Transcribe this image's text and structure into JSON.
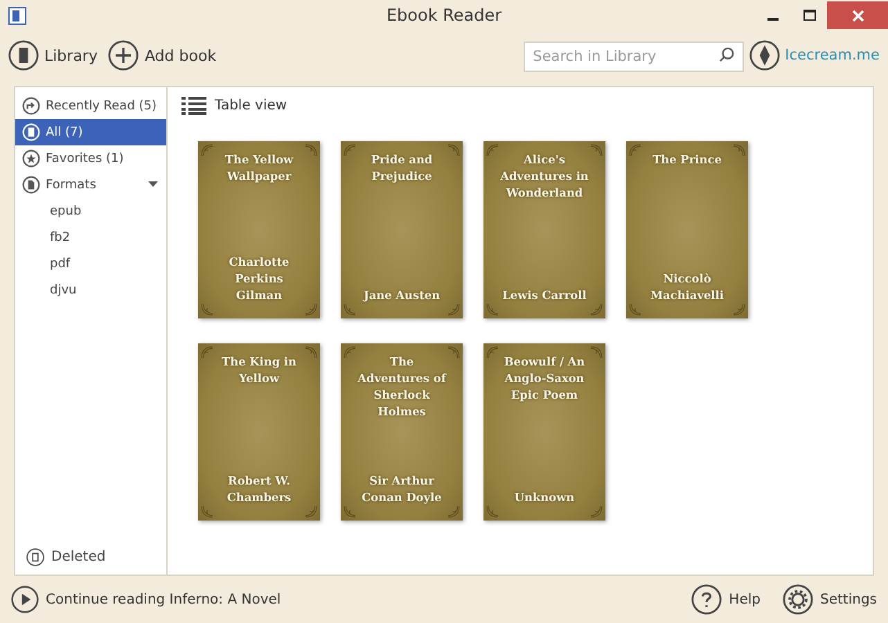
{
  "window": {
    "title": "Ebook Reader"
  },
  "toolbar": {
    "library": "Library",
    "add_book": "Add book",
    "search": {
      "placeholder": "Search in Library"
    },
    "brand": "Icecream.me"
  },
  "sidebar": {
    "items": [
      {
        "kind": "recent",
        "label": "Recently Read (5)",
        "selected": false
      },
      {
        "kind": "all",
        "label": "All (7)",
        "selected": true
      },
      {
        "kind": "favorites",
        "label": "Favorites (1)",
        "selected": false
      },
      {
        "kind": "formats",
        "label": "Formats",
        "selected": false,
        "expanded": true,
        "children": [
          {
            "label": "epub",
            "selected": false
          },
          {
            "label": "fb2",
            "selected": false
          },
          {
            "label": "pdf",
            "selected": false
          },
          {
            "label": "djvu",
            "selected": false
          }
        ]
      }
    ],
    "deleted": "Deleted"
  },
  "view_toggle": "Table view",
  "books": [
    {
      "title": "The Yellow Wallpaper",
      "author": "Charlotte Perkins Gilman"
    },
    {
      "title": "Pride and Prejudice",
      "author": "Jane Austen"
    },
    {
      "title": "Alice's Adventures in Wonderland",
      "author": "Lewis Carroll"
    },
    {
      "title": "The Prince",
      "author": "Niccolò Machiavelli"
    },
    {
      "title": "The King in Yellow",
      "author": "Robert W. Chambers"
    },
    {
      "title": "The Adventures of Sherlock Holmes",
      "author": "Sir Arthur Conan Doyle"
    },
    {
      "title": "Beowulf / An Anglo-Saxon Epic Poem",
      "author": "Unknown"
    }
  ],
  "status_bar": {
    "continue": "Continue reading Inferno: A Novel",
    "help": "Help",
    "settings": "Settings"
  }
}
